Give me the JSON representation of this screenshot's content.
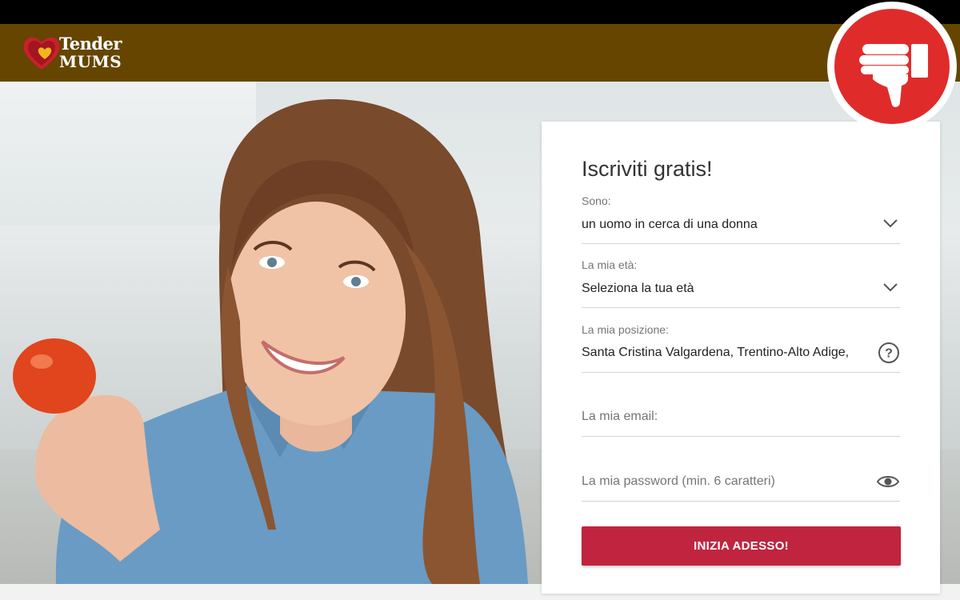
{
  "brand": {
    "logo_line1": "Tender",
    "logo_line2": "MUMS"
  },
  "form": {
    "title": "Iscriviti gratis!",
    "gender": {
      "label": "Sono:",
      "value": "un uomo in cerca di una donna"
    },
    "age": {
      "label": "La mia età:",
      "value": "Seleziona la tua età"
    },
    "location": {
      "label": "La mia posizione:",
      "value": "Santa Cristina Valgardena, Trentino-Alto Adige,"
    },
    "email": {
      "placeholder": "La mia email:"
    },
    "password": {
      "placeholder": "La mia password (min. 6 caratteri)"
    },
    "submit_label": "INIZIA ADESSO!"
  },
  "badge": {
    "icon": "thumbs-down-icon",
    "color": "#e02b2b"
  },
  "colors": {
    "header": "#654500",
    "accent": "#c0243f"
  }
}
